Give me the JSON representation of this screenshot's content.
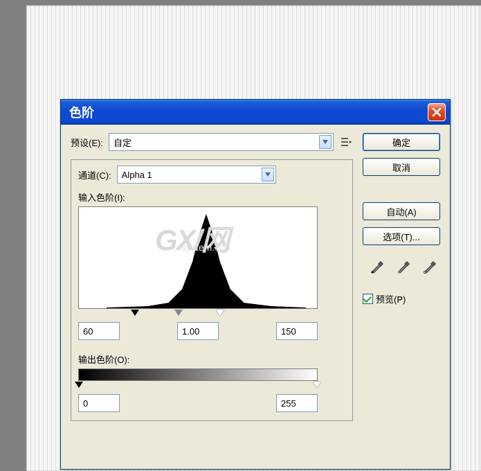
{
  "window": {
    "title": "色阶"
  },
  "preset": {
    "label": "预设(E):",
    "value": "自定"
  },
  "channel": {
    "label": "通道(C):",
    "value": "Alpha 1"
  },
  "input_levels": {
    "label": "输入色阶(I):",
    "shadow": "60",
    "midtone": "1.00",
    "highlight": "150"
  },
  "output_levels": {
    "label": "输出色阶(O):",
    "low": "0",
    "high": "255"
  },
  "buttons": {
    "ok": "确定",
    "cancel": "取消",
    "auto": "自动(A)",
    "options": "选项(T)..."
  },
  "preview": {
    "label": "预览(P)",
    "checked": true
  },
  "watermark": {
    "main": "GX/网",
    "sub": "system.con"
  },
  "colors": {
    "titlebar": "#0b4ad1",
    "dialog_bg": "#ece9d8",
    "border": "#7f9db9"
  }
}
